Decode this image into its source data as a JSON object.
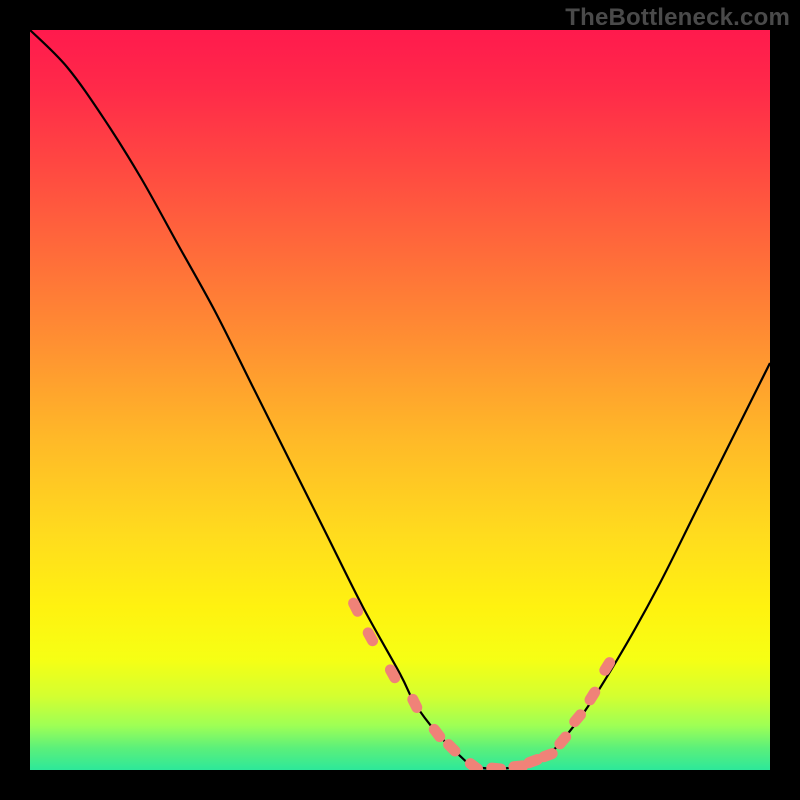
{
  "watermark": "TheBottleneck.com",
  "chart_data": {
    "type": "line",
    "title": "",
    "xlabel": "",
    "ylabel": "",
    "xlim": [
      0,
      100
    ],
    "ylim": [
      0,
      100
    ],
    "grid": false,
    "series": [
      {
        "name": "curve",
        "x": [
          0,
          5,
          10,
          15,
          20,
          25,
          30,
          35,
          40,
          45,
          50,
          52,
          55,
          58,
          60,
          63,
          66,
          70,
          75,
          80,
          85,
          90,
          95,
          100
        ],
        "y": [
          100,
          95,
          88,
          80,
          71,
          62,
          52,
          42,
          32,
          22,
          13,
          9,
          5,
          2,
          0.5,
          0.2,
          0.5,
          2,
          8,
          16,
          25,
          35,
          45,
          55
        ]
      }
    ],
    "markers": {
      "name": "highlight-points",
      "x": [
        44,
        46,
        49,
        52,
        55,
        57,
        60,
        63,
        66,
        68,
        70,
        72,
        74,
        76,
        78
      ],
      "y": [
        22,
        18,
        13,
        9,
        5,
        3,
        0.5,
        0.2,
        0.5,
        1.2,
        2,
        4,
        7,
        10,
        14
      ]
    },
    "background_gradient": {
      "stops": [
        {
          "offset": 0.0,
          "color": "#ff1a4d"
        },
        {
          "offset": 0.08,
          "color": "#ff2a49"
        },
        {
          "offset": 0.18,
          "color": "#ff4742"
        },
        {
          "offset": 0.3,
          "color": "#ff6b3a"
        },
        {
          "offset": 0.42,
          "color": "#ff8f32"
        },
        {
          "offset": 0.55,
          "color": "#ffb828"
        },
        {
          "offset": 0.68,
          "color": "#ffdb1e"
        },
        {
          "offset": 0.78,
          "color": "#fff210"
        },
        {
          "offset": 0.85,
          "color": "#f6ff14"
        },
        {
          "offset": 0.9,
          "color": "#d4ff30"
        },
        {
          "offset": 0.94,
          "color": "#9eff55"
        },
        {
          "offset": 0.97,
          "color": "#5cf07a"
        },
        {
          "offset": 1.0,
          "color": "#2de89a"
        }
      ]
    },
    "marker_color": "#f08278",
    "curve_color": "#000000"
  }
}
